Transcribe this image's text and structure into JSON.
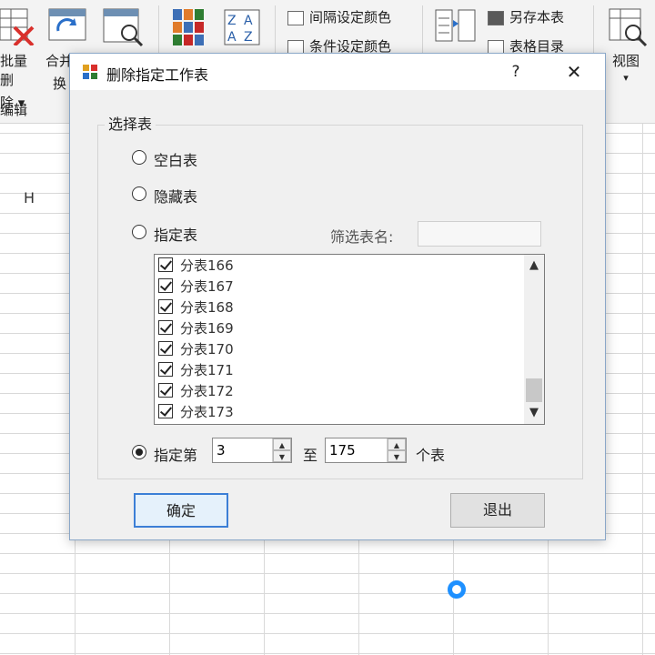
{
  "ribbon": {
    "left_cut_label_1": "批量删",
    "left_cut_label_2": "除 ▾",
    "merge_label_1": "合并",
    "merge_label_2": "换",
    "edit_group": "编辑",
    "interval_color": "间隔设定颜色",
    "condition_color": "条件设定颜色",
    "save_sheet": "另存本表",
    "sheet_directory": "表格目录",
    "view_label": "视图",
    "view_arrow": "▾"
  },
  "sheet": {
    "column_header": "H"
  },
  "dialog": {
    "title": "删除指定工作表",
    "help": "?",
    "close": "✕",
    "group_label": "选择表",
    "radio_blank": "空白表",
    "radio_hidden": "隐藏表",
    "radio_specified": "指定表",
    "filter_label": "筛选表名:",
    "filter_value": "",
    "list_items": [
      "分表166",
      "分表167",
      "分表168",
      "分表169",
      "分表170",
      "分表171",
      "分表172",
      "分表173"
    ],
    "radio_range": "指定第",
    "range_from": "3",
    "range_to_label": "至",
    "range_to": "175",
    "range_suffix": "个表",
    "ok_button": "确定",
    "exit_button": "退出"
  }
}
